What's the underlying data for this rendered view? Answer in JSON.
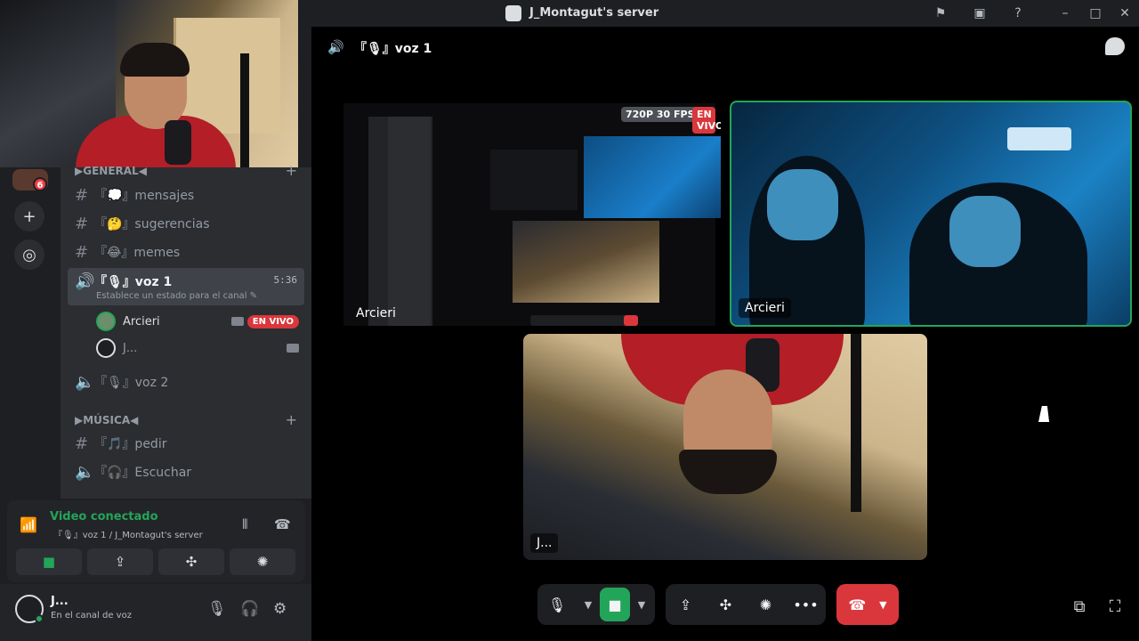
{
  "window": {
    "title": "J_Montagut's server"
  },
  "rail": {
    "badge_count": "6",
    "add_icon": "plus-icon",
    "explore_icon": "compass-icon"
  },
  "channels": {
    "categories": [
      {
        "label": "▶GENERAL◀"
      },
      {
        "label": "▶MÚSICA◀"
      }
    ],
    "text_channels": [
      {
        "label": "『💭』mensajes"
      },
      {
        "label": "『🤔』sugerencias"
      },
      {
        "label": "『😂』memes"
      },
      {
        "label": "『🎵』pedir"
      }
    ],
    "voice_active": {
      "label": "『🎙』voz 1",
      "time": "5:36",
      "status": "Establece un estado para el canal ✎"
    },
    "members": [
      {
        "name": "Arcieri",
        "live": "EN VIVO"
      },
      {
        "name": "J..."
      }
    ],
    "voice_channels": [
      {
        "label": "『🎙』voz 2"
      },
      {
        "label": "『🎧』Escuchar"
      }
    ]
  },
  "voice_panel": {
    "title": "Video conectado",
    "subtitle": "『🎙』voz 1 / J_Montagut's server"
  },
  "user_panel": {
    "name": "J...",
    "status": "En el canal de voz"
  },
  "stage": {
    "header": "『🎙』voz 1",
    "tiles": [
      {
        "label": "Arcieri",
        "badge_quality": "720P 30 FPS",
        "badge_live": "EN VIVO"
      },
      {
        "label": "Arcieri"
      },
      {
        "label": "J..."
      }
    ]
  },
  "colors": {
    "accent_green": "#23a559",
    "danger_red": "#da373c",
    "background": "#1e1f22"
  }
}
